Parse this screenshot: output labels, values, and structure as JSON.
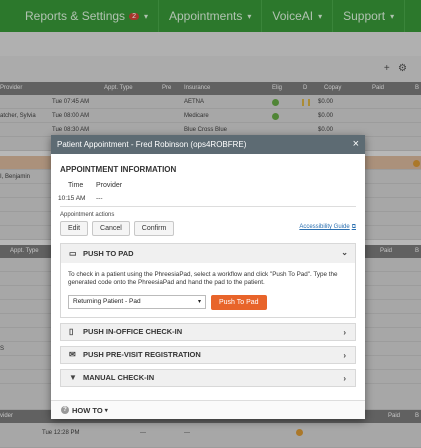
{
  "nav": {
    "items": [
      {
        "label": "Reports & Settings",
        "badge": "2"
      },
      {
        "label": "Appointments"
      },
      {
        "label": "VoiceAI"
      },
      {
        "label": "Support"
      }
    ]
  },
  "toolbar": {
    "add_icon": "+",
    "settings_icon": "⚙"
  },
  "grid": {
    "headers": [
      "Provider",
      "Appt. Type",
      "Pre",
      "Insurance",
      "Elig",
      "D",
      "Copay",
      "Paid",
      "B"
    ],
    "rows": [
      {
        "time": "Tue 07:45 AM",
        "provider": "",
        "insurance": "AETNA",
        "copay": "$0.00"
      },
      {
        "time": "Tue 08:00 AM",
        "provider": "atcher, Sylvia",
        "insurance": "Medicare",
        "copay": "$0.00"
      },
      {
        "time": "Tue 08:30 AM",
        "provider": "",
        "insurance": "Blue Cross Blue",
        "copay": "$0.00"
      }
    ],
    "side_label": "I, Benjamin",
    "second_header": [
      "Appt. Type",
      "Paid",
      "B"
    ],
    "third_header": [
      "vider",
      "Paid",
      "B"
    ],
    "last_row_time": "Tue 12:28 PM",
    "last_row_dashes": "---",
    "side_s": "S"
  },
  "modal": {
    "title": "Patient Appointment - Fred Robinson (ops4ROBFRE)",
    "close_icon": "×",
    "section_title": "APPOINTMENT INFORMATION",
    "time_header": "Time",
    "provider_header": "Provider",
    "time_value": "10:15 AM",
    "provider_value": "---",
    "actions_label": "Appointment actions",
    "edit_label": "Edit",
    "cancel_label": "Cancel",
    "confirm_label": "Confirm",
    "accessibility_label": "Accessibility Guide",
    "push_to_pad": {
      "title": "PUSH TO PAD",
      "instructions": "To check in a patient using the PhreesiaPad, select a workflow and click \"Push To Pad\". Type the generated code onto the PhreesiaPad and hand the pad to the patient.",
      "select_value": "Returning Patient - Pad",
      "button_label": "Push To Pad"
    },
    "panels": [
      {
        "title": "PUSH IN-OFFICE CHECK-IN"
      },
      {
        "title": "PUSH PRE-VISIT REGISTRATION"
      },
      {
        "title": "MANUAL CHECK-IN"
      }
    ],
    "footer_label": "HOW TO",
    "help_icon": "?"
  },
  "colors": {
    "nav_green": "#2e8a2e",
    "modal_header": "#5d6b73",
    "accent_orange": "#e8642a",
    "link_blue": "#2a6fb0"
  }
}
